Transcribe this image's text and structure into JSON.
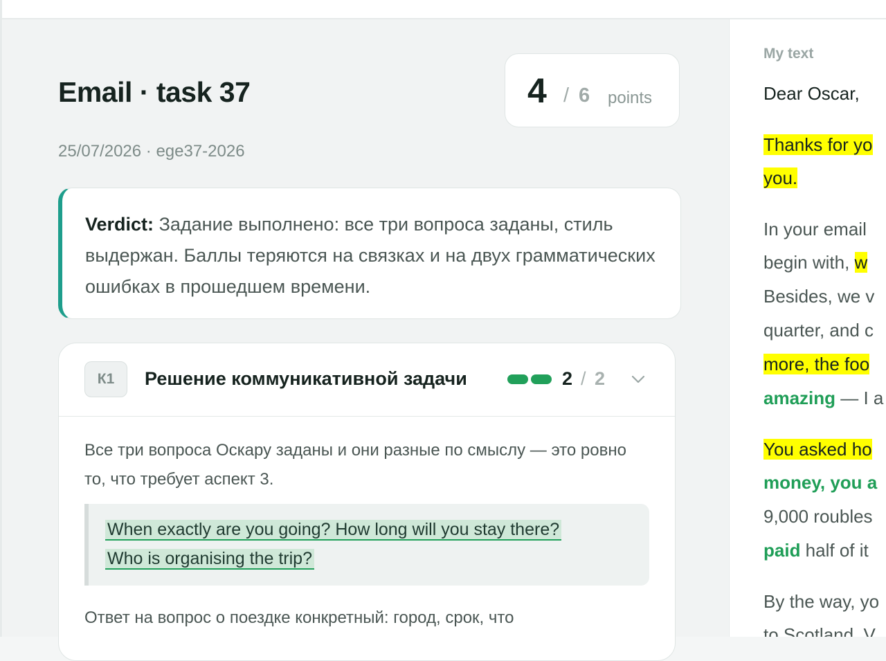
{
  "header": {
    "title": "Email · task 37",
    "meta": "25/07/2026 · ege37-2026"
  },
  "score": {
    "value": "4",
    "separator": "/",
    "max": "6",
    "unit": "points"
  },
  "verdict": {
    "label": "Verdict:",
    "text": "Задание выполнено: все три вопроса заданы, стиль выдержан. Баллы теряются на связках и на двух грамматических ошибках в прошедшем времени."
  },
  "criterion": {
    "code": "К1",
    "title": "Решение коммуникативной задачи",
    "score": "2",
    "separator": "/",
    "max": "2",
    "filled_fraction": 1.0,
    "comment": "Все три вопроса Оскару заданы и они разные по смыслу — это ровно то, что требует аспект 3.",
    "quote": "When exactly are you going? How long will you stay there? Who is organising the trip?",
    "comment_2": "Ответ на вопрос о поездке конкретный: город, срок, что"
  },
  "my_text": {
    "label": "My text",
    "greeting": "Dear Oscar,",
    "lines": [
      {
        "text": "Thanks for yo",
        "style": "highlight"
      },
      {
        "text": "you.",
        "style": "highlight"
      },
      {
        "text": "In your email",
        "style": "plain"
      },
      {
        "pre": "begin with, ",
        "text": "w",
        "style": "highlight-tail"
      },
      {
        "text": "Besides, we v",
        "style": "plain"
      },
      {
        "text": "quarter, and c",
        "style": "plain"
      },
      {
        "text": "more, the foo",
        "style": "highlight"
      },
      {
        "pre_bold": "amazing",
        "text": " — I a",
        "style": "green-lead"
      },
      {
        "text": "You asked ho",
        "style": "highlight"
      },
      {
        "text": "money, you a",
        "style": "green"
      },
      {
        "text": "9,000 roubles",
        "style": "plain"
      },
      {
        "pre_bold": "paid",
        "text": " half of it",
        "style": "green-lead"
      },
      {
        "text": "By the way, yo",
        "style": "plain"
      },
      {
        "text": "to Scotland. V",
        "style": "plain"
      }
    ]
  },
  "colors": {
    "accent_teal": "#1e9e8c",
    "success_green": "#21a05a",
    "highlight_yellow": "#ffff00"
  },
  "icons": {
    "chevron": "chevron-down-icon"
  }
}
